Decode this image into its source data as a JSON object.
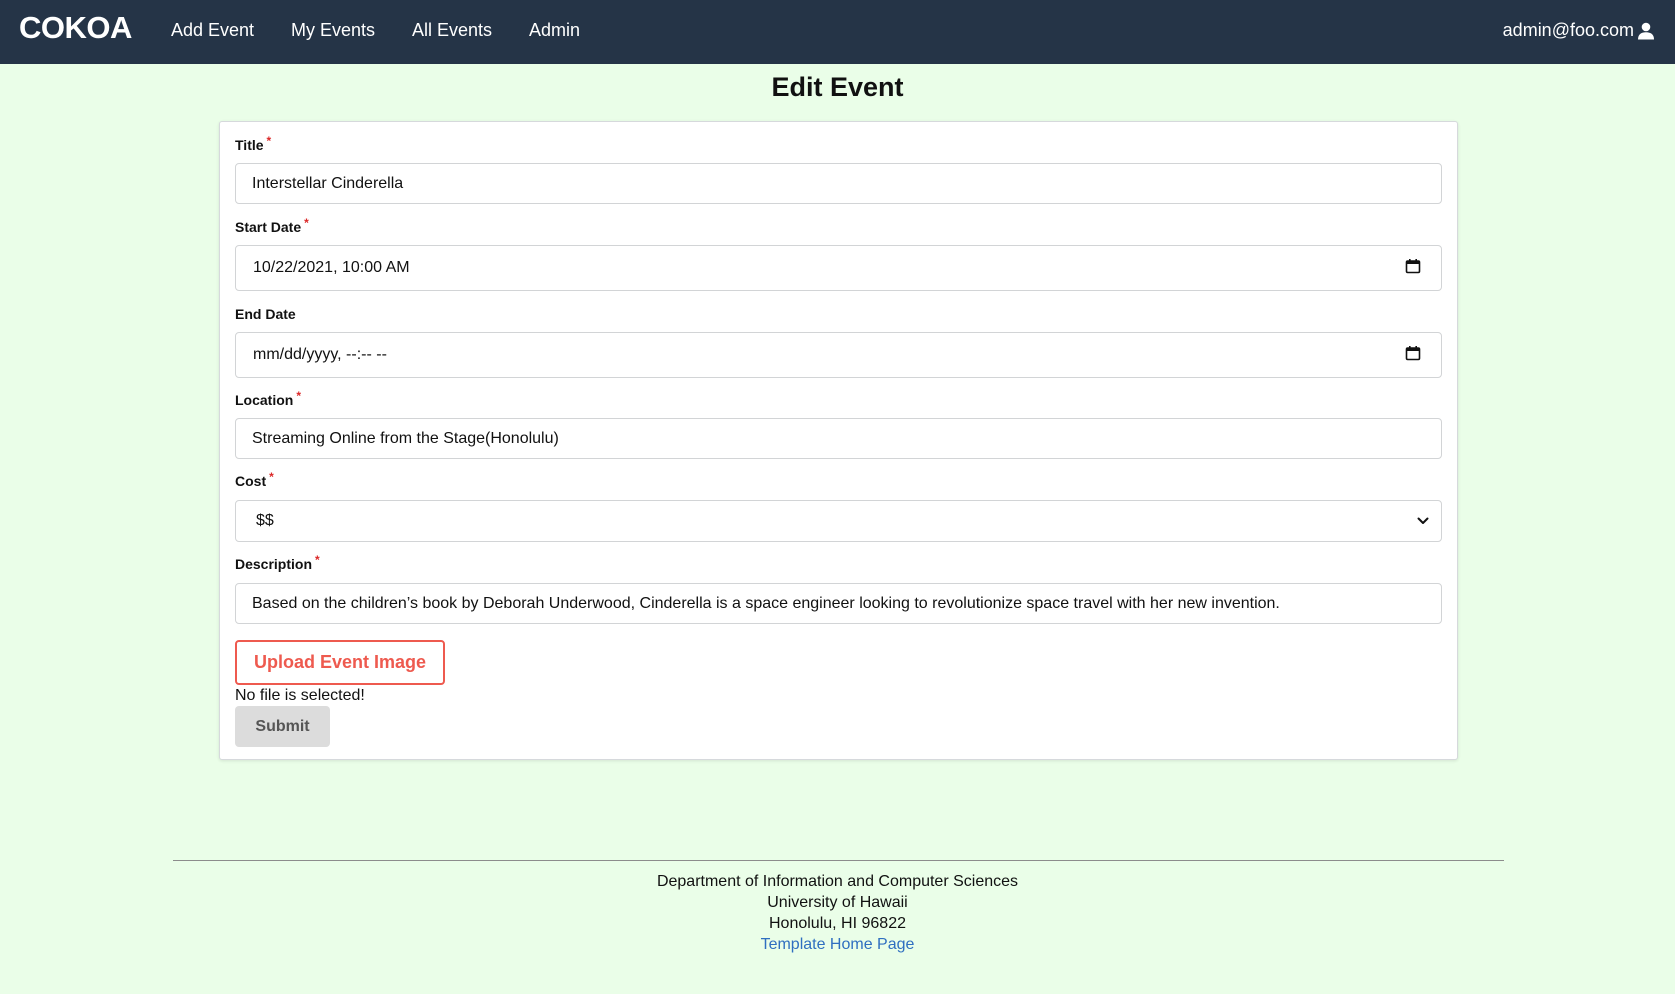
{
  "navbar": {
    "brand": "COKOA",
    "links": [
      "Add Event",
      "My Events",
      "All Events",
      "Admin"
    ],
    "user_email": "admin@foo.com",
    "user_icon": "user-icon",
    "background": "#253447"
  },
  "page": {
    "title": "Edit Event",
    "background": "#eafee8"
  },
  "form": {
    "title": {
      "label": "Title",
      "value": "Interstellar Cinderella"
    },
    "start_date": {
      "label": "Start Date",
      "value": "10/22/2021, 10:00 AM"
    },
    "end_date": {
      "label": "End Date",
      "placeholder": "mm/dd/yyyy, --:-- --"
    },
    "location": {
      "label": "Location",
      "value": "Streaming Online from the Stage(Honolulu)"
    },
    "cost": {
      "label": "Cost",
      "value": "$$"
    },
    "description": {
      "label": "Description",
      "value": "Based on the children’s book by Deborah Underwood, Cinderella is a space engineer looking to revolutionize space travel with her new invention."
    },
    "required_mark": "*",
    "upload_label": "Upload Event Image",
    "file_status": "No file is selected!",
    "submit_label": "Submit",
    "accent_color": "#ee5a4f",
    "required_color": "#db2828"
  },
  "footer": {
    "line1": "Department of Information and Computer Sciences",
    "line2": "University of Hawaii",
    "line3": "Honolulu, HI 96822",
    "link": "Template Home Page",
    "link_color": "#2f6fc0"
  }
}
